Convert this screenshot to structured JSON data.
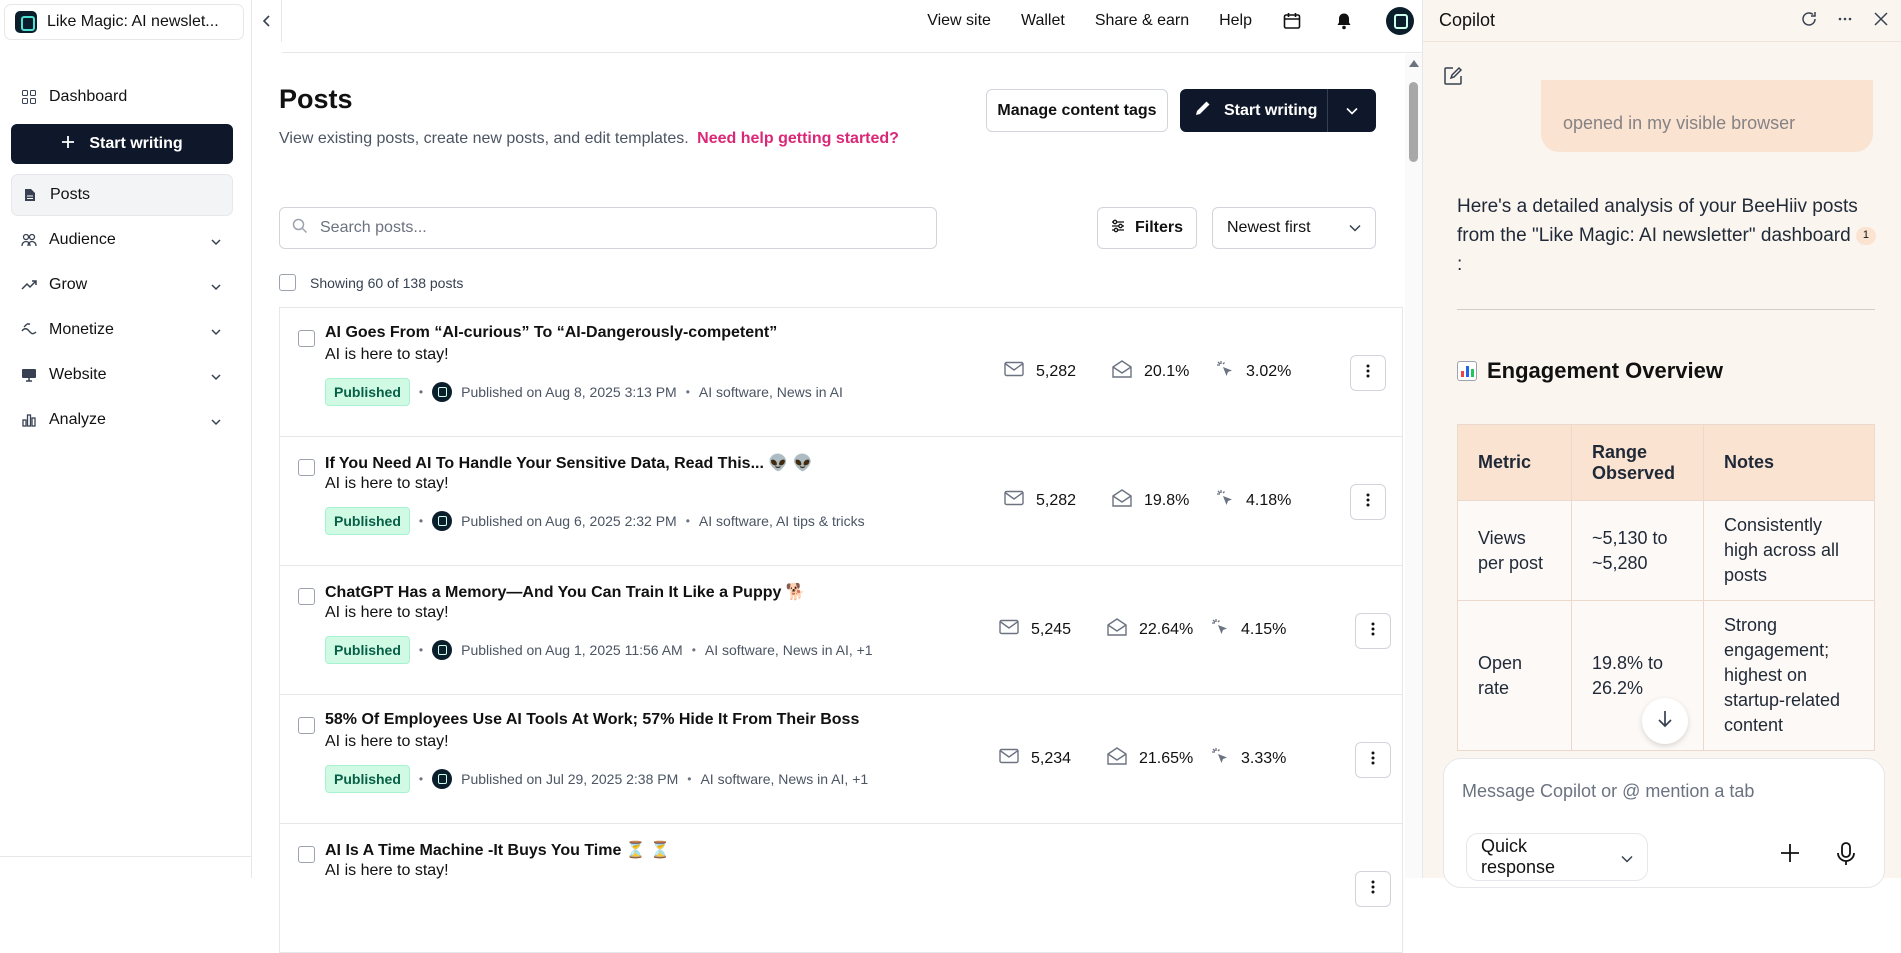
{
  "sidebar": {
    "publication_name": "Like Magic: AI newslet...",
    "dashboard_label": "Dashboard",
    "start_writing_label": "Start writing",
    "items": [
      {
        "label": "Posts",
        "icon": "document-icon"
      },
      {
        "label": "Audience",
        "icon": "audience-icon"
      },
      {
        "label": "Grow",
        "icon": "trend-icon"
      },
      {
        "label": "Monetize",
        "icon": "monetize-icon"
      },
      {
        "label": "Website",
        "icon": "monitor-icon"
      },
      {
        "label": "Analyze",
        "icon": "bar-chart-icon"
      }
    ]
  },
  "topnav": {
    "view_site": "View site",
    "wallet": "Wallet",
    "share_earn": "Share & earn",
    "help": "Help"
  },
  "main": {
    "title": "Posts",
    "subtitle": "View existing posts, create new posts, and edit templates.",
    "help_link": "Need help getting started?",
    "manage_tags_label": "Manage content tags",
    "start_writing_label": "Start writing",
    "search_placeholder": "Search posts...",
    "filters_label": "Filters",
    "sort_value": "Newest first",
    "showing_text": "Showing 60 of 138 posts"
  },
  "posts": [
    {
      "title": "AI Goes From “AI-curious” To “AI-Dangerously-competent”",
      "subtitle": "AI is here to stay!",
      "status": "Published",
      "published": "Published on Aug 8, 2025 3:13 PM",
      "tags": "AI software, News in AI",
      "recipients": "5,282",
      "open_rate": "20.1%",
      "click_rate": "3.02%"
    },
    {
      "title": "If You Need AI To Handle Your Sensitive Data, Read This... 👽 👽",
      "subtitle": "AI is here to stay!",
      "status": "Published",
      "published": "Published on Aug 6, 2025 2:32 PM",
      "tags": "AI software, AI tips & tricks",
      "recipients": "5,282",
      "open_rate": "19.8%",
      "click_rate": "4.18%"
    },
    {
      "title": "ChatGPT Has a Memory—And You Can Train It Like a Puppy 🐕",
      "subtitle": "AI is here to stay!",
      "status": "Published",
      "published": "Published on Aug 1, 2025 11:56 AM",
      "tags": "AI software, News in AI, +1",
      "recipients": "5,245",
      "open_rate": "22.64%",
      "click_rate": "4.15%"
    },
    {
      "title": "58% Of Employees Use AI Tools At Work; 57% Hide It From Their Boss",
      "subtitle": "AI is here to stay!",
      "status": "Published",
      "published": "Published on Jul 29, 2025 2:38 PM",
      "tags": "AI software, News in AI, +1",
      "recipients": "5,234",
      "open_rate": "21.65%",
      "click_rate": "3.33%"
    },
    {
      "title": "AI Is A Time Machine -It Buys You Time ⏳ ⏳",
      "subtitle": "AI is here to stay!",
      "status": "",
      "published": "",
      "tags": "",
      "recipients": "",
      "open_rate": "",
      "click_rate": ""
    }
  ],
  "copilot": {
    "title": "Copilot",
    "prev_bubble_text": "opened in my visible browser",
    "message": "Here's a detailed analysis of your BeeHiiv posts from the \"Like Magic: AI newsletter\" dashboard",
    "citation": "1",
    "section_heading": "Engagement Overview",
    "table": {
      "headers": [
        "Metric",
        "Range Observed",
        "Notes"
      ],
      "rows": [
        [
          "Views per post",
          "~5,130 to ~5,280",
          "Consistently high across all posts"
        ],
        [
          "Open rate",
          "19.8% to 26.2%",
          "Strong engagement; highest on startup-related content"
        ]
      ]
    },
    "composer_placeholder": "Message Copilot or @ mention a tab",
    "quick_response_label": "Quick response"
  }
}
